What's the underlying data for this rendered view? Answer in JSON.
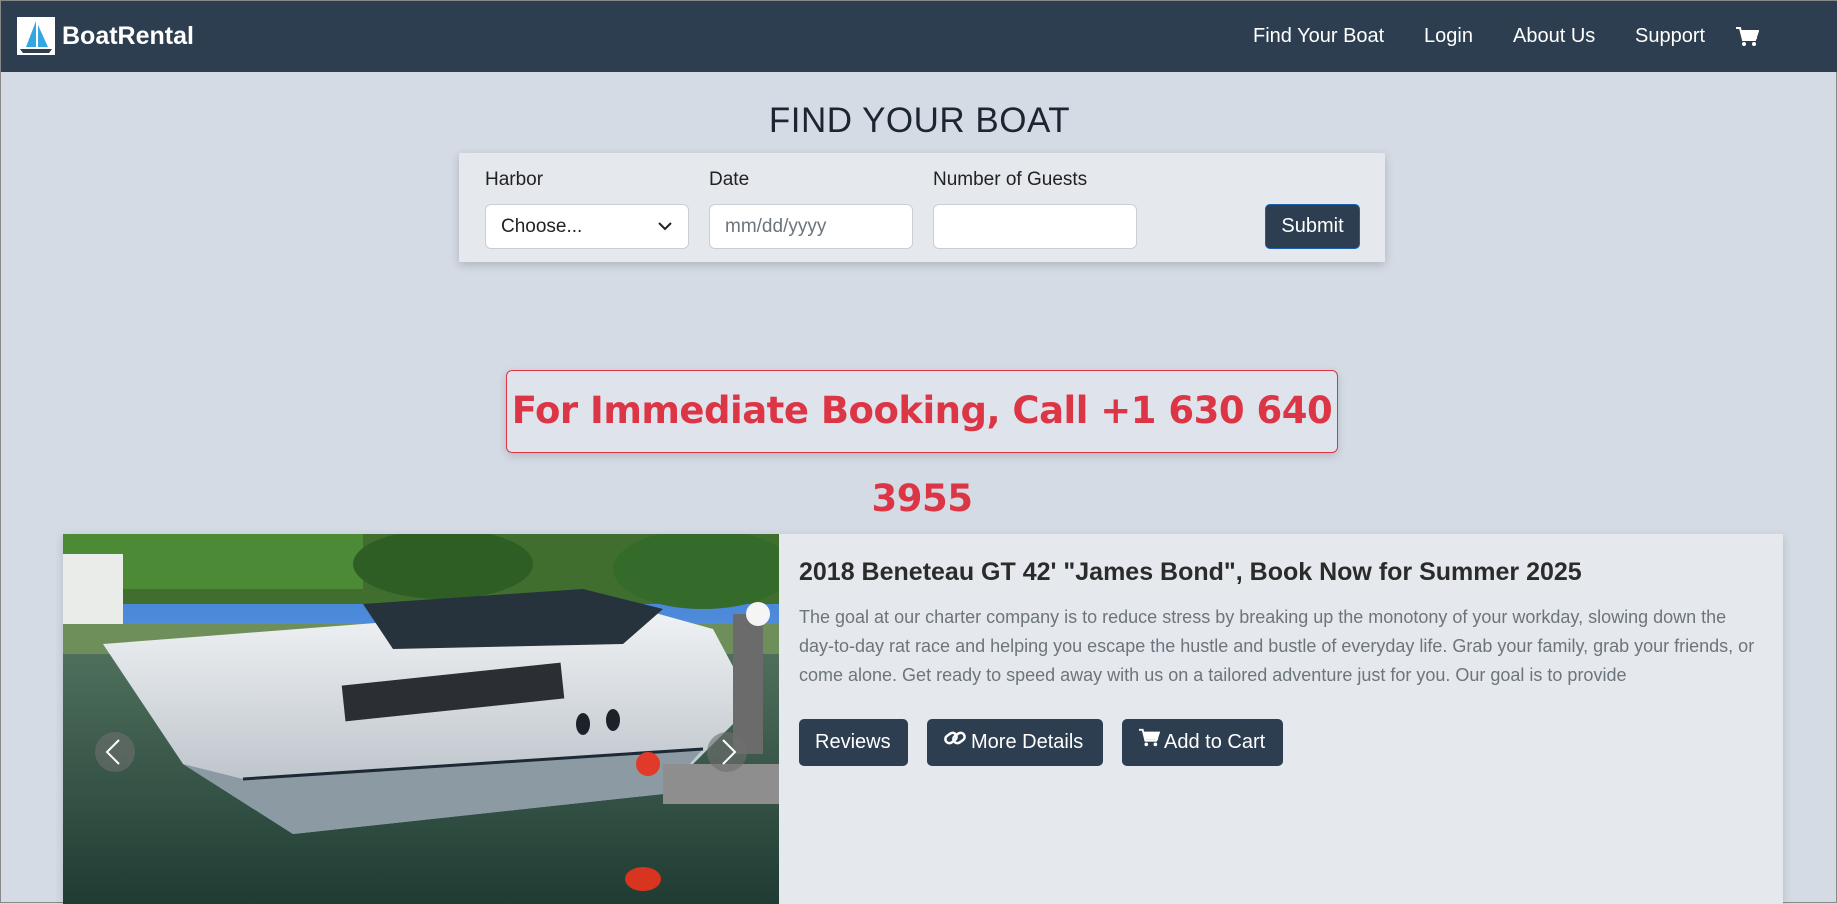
{
  "navbar": {
    "brand": "BoatRental",
    "links": [
      "Find Your Boat",
      "Login",
      "About Us",
      "Support"
    ],
    "cart_icon": "cart-icon"
  },
  "search": {
    "title": "FIND YOUR BOAT",
    "harbor_label": "Harbor",
    "harbor_value": "Choose...",
    "date_label": "Date",
    "date_placeholder": "mm/dd/yyyy",
    "guests_label": "Number of Guests",
    "guests_value": "",
    "submit_label": "Submit"
  },
  "call_banner": "For Immediate Booking, Call +1 630 640 3955",
  "boat": {
    "title": "2018 Beneteau GT 42' \"James Bond\", Book Now for Summer 2025",
    "description": "The goal at our charter company is to reduce stress by breaking up the monotony of your workday, slowing down the day-to-day rat race and helping you escape the hustle and bustle of everyday life. Grab your family, grab your friends, or come alone. Get ready to speed away with us on a tailored adventure just for you. Our goal is to provide",
    "reviews_label": "Reviews",
    "details_label": "More Details",
    "cart_label": "Add to Cart"
  },
  "colors": {
    "nav_bg": "#2c3e50",
    "page_bg": "#d4dbe5",
    "accent_red": "#dc3545"
  }
}
